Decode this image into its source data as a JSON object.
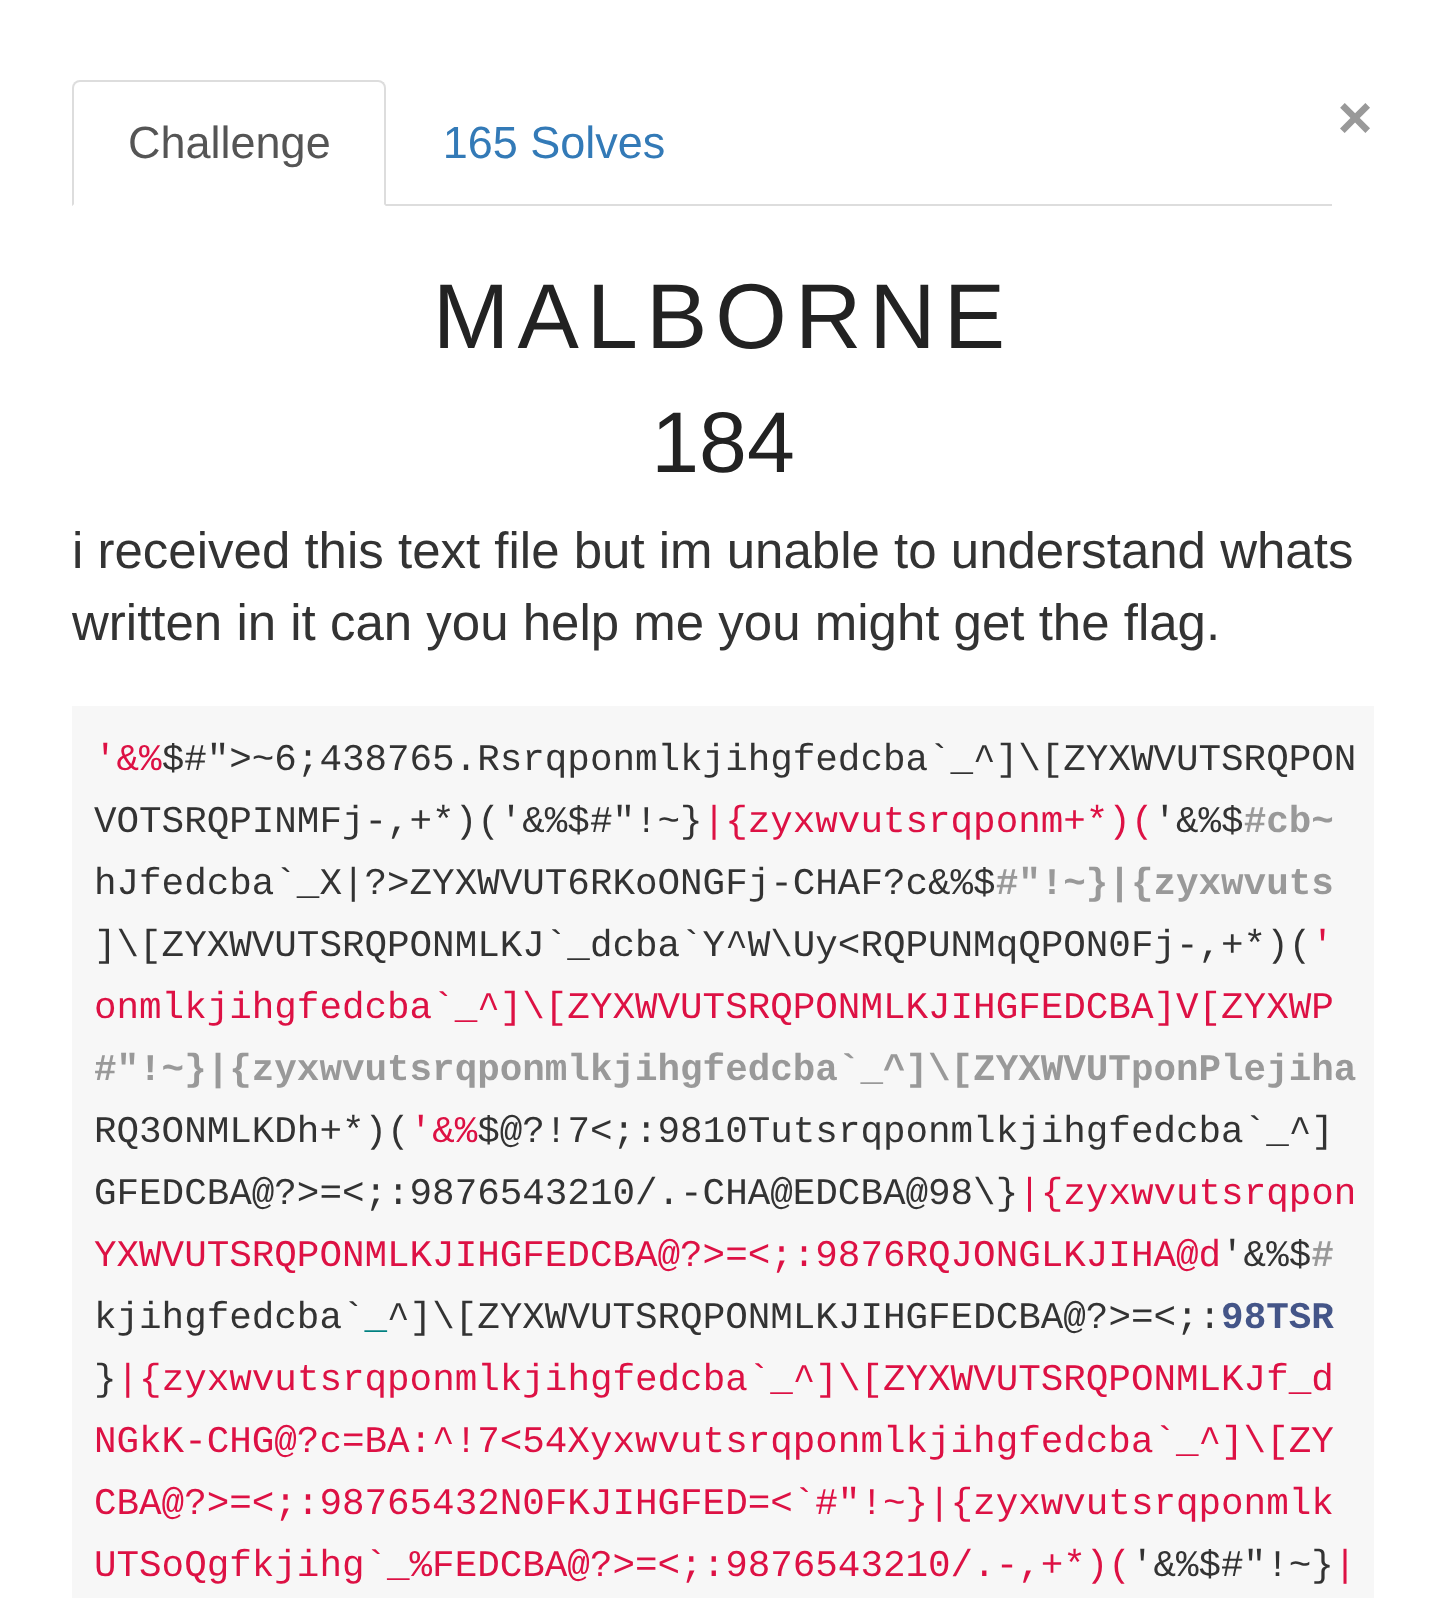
{
  "tabs": [
    {
      "label": "Challenge",
      "selected": true
    },
    {
      "label": "165 Solves",
      "selected": false
    }
  ],
  "close": {
    "label": "×"
  },
  "challenge": {
    "name": "MALBORNE",
    "points": "184",
    "description": "i received this text file but im unable to understand whats written in it can you help me you might get the flag."
  },
  "code": {
    "lines": [
      {
        "segments": [
          {
            "kind": "string",
            "text": "'&%"
          },
          {
            "kind": "plain",
            "text": "$#\">~6;438765.Rsrqponmlkjihgfedcba`_^]\\[ZYXWVUTSRQPON"
          }
        ]
      },
      {
        "segments": [
          {
            "kind": "plain",
            "text": "VOTSRQPINMFj-,+*)('&%$#\"!~}"
          },
          {
            "kind": "string",
            "text": "|{zyxwvutsrqponm+*)("
          },
          {
            "kind": "plain",
            "text": "'&%$"
          },
          {
            "kind": "comment",
            "text": "#cb~"
          }
        ]
      },
      {
        "segments": [
          {
            "kind": "plain",
            "text": "hJfedcba`_X|?>ZYXWVUT6RKoONGFj-CHAF?c&%$"
          },
          {
            "kind": "comment",
            "text": "#\"!~}|{zyxwvuts"
          }
        ]
      },
      {
        "segments": [
          {
            "kind": "plain",
            "text": "]\\[ZYXWVUTSRQPONMLKJ`_dcba`Y^W\\Uy<RQPUNMqQPON0Fj-,+*)("
          },
          {
            "kind": "string",
            "text": "'"
          }
        ]
      },
      {
        "segments": [
          {
            "kind": "string",
            "text": "onmlkjihgfedcba`_^]\\[ZYXWVUTSRQPONMLKJIHGFEDCBA]V[ZYXWP"
          }
        ]
      },
      {
        "segments": [
          {
            "kind": "comment",
            "text": "#\"!~}|{zyxwvutsrqponmlkjihgfedcba`_^]\\[ZYXWVUTponPlejiha"
          }
        ]
      },
      {
        "segments": [
          {
            "kind": "plain",
            "text": "RQ3ONMLKDh+*)("
          },
          {
            "kind": "string",
            "text": "'&%"
          },
          {
            "kind": "plain",
            "text": "$@?!7<;:9810Tutsrqponmlkjihgfedcba`_^]"
          }
        ]
      },
      {
        "segments": [
          {
            "kind": "plain",
            "text": "GFEDCBA@?>=<;:9876543210/.-CHA@EDCBA@98\\}"
          },
          {
            "kind": "string",
            "text": "|{zyxwvutsrqpon"
          }
        ]
      },
      {
        "segments": [
          {
            "kind": "string",
            "text": "YXWVUTSRQPONMLKJIHGFEDCBA@?>=<;:9876RQJONGLKJIHA@d"
          },
          {
            "kind": "plain",
            "text": "'&%$"
          },
          {
            "kind": "comment",
            "text": "#"
          }
        ]
      },
      {
        "segments": [
          {
            "kind": "plain",
            "text": "kjihgfedcba`"
          },
          {
            "kind": "variable",
            "text": "_"
          },
          {
            "kind": "plain",
            "text": "^]\\[ZYXWVUTSRQPONMLKJIHGFEDCBA@?>=<;:"
          },
          {
            "kind": "number",
            "text": "98TSR"
          }
        ]
      },
      {
        "segments": [
          {
            "kind": "plain",
            "text": "}"
          },
          {
            "kind": "string",
            "text": "|{zyxwvutsrqponmlkjihgfedcba`_^]\\[ZYXWVUTSRQPONMLKJf_d"
          }
        ]
      },
      {
        "segments": [
          {
            "kind": "string",
            "text": "NGkK-CHG@?c=BA:^!7<54Xyxwvutsrqponmlkjihgfedcba`_^]\\[ZY"
          }
        ]
      },
      {
        "segments": [
          {
            "kind": "string",
            "text": "CBA@?>=<;:98765432N0FKJIHGFED=<`#\"!~}|{zyxwvutsrqponmlk"
          }
        ]
      },
      {
        "segments": [
          {
            "kind": "string",
            "text": "UTSoQgfkjihg`_%FEDCBA@?>=<;:9876543210/.-,+*)("
          },
          {
            "kind": "plain",
            "text": "'&%$#\"!~}"
          },
          {
            "kind": "string",
            "text": "|"
          }
        ]
      }
    ]
  }
}
